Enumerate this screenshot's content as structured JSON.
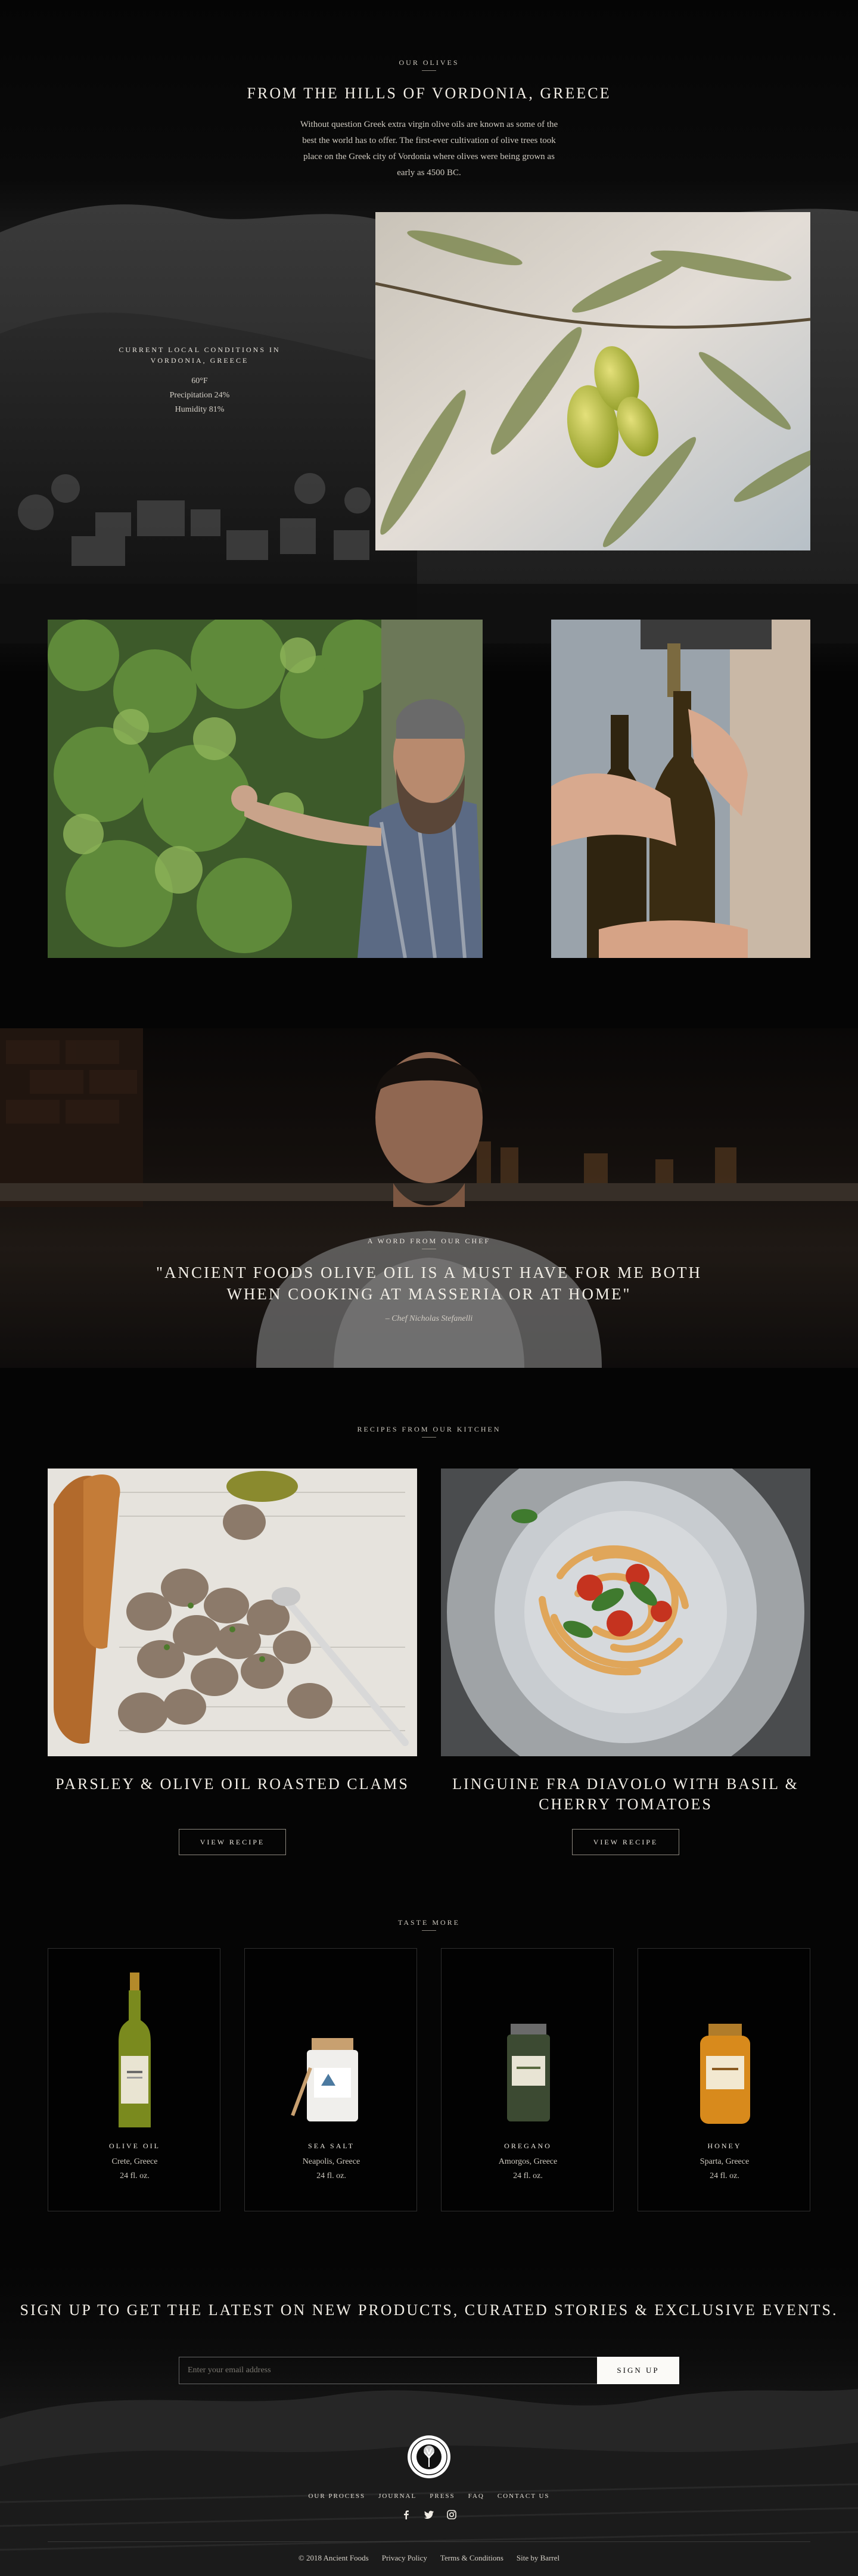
{
  "olives": {
    "eyebrow": "Our Olives",
    "title": "From the Hills of Vordonia, Greece",
    "intro": "Without question Greek extra virgin olive oils are known as some of the best the world has to offer. The first-ever cultivation of olive trees took place on the Greek city of Vordonia where olives were being grown as early as 4500 BC."
  },
  "conditions": {
    "title": "Current Local Conditions in Vordonia, Greece",
    "temperature": "60°F",
    "precipitation": "Precipitation 24%",
    "humidity": "Humidity 81%"
  },
  "chef": {
    "eyebrow": "A Word From Our Chef",
    "quote": "\"Ancient Foods olive oil is a must have for me both when cooking at Masseria or at home\"",
    "cite": "– Chef Nicholas Stefanelli"
  },
  "recipes": {
    "eyebrow": "Recipes From Our Kitchen",
    "items": [
      {
        "title": "Parsley & Olive Oil Roasted Clams",
        "button": "View Recipe"
      },
      {
        "title": "Linguine Fra Diavolo with Basil & Cherry Tomatoes",
        "button": "View Recipe"
      }
    ]
  },
  "taste": {
    "eyebrow": "Taste More",
    "products": [
      {
        "name": "Olive Oil",
        "origin": "Crete, Greece",
        "size": "24 fl. oz."
      },
      {
        "name": "Sea Salt",
        "origin": "Neapolis, Greece",
        "size": "24 fl. oz."
      },
      {
        "name": "Oregano",
        "origin": "Amorgos, Greece",
        "size": "24 fl. oz."
      },
      {
        "name": "Honey",
        "origin": "Sparta, Greece",
        "size": "24 fl. oz."
      }
    ]
  },
  "signup": {
    "title": "Sign Up to Get the Latest on New Products, Curated Stories & Exclusive Events.",
    "placeholder": "Enter your email address",
    "button": "Sign Up"
  },
  "footer": {
    "logo_text": "Ancient Foods",
    "nav": [
      "Our Process",
      "Journal",
      "Press",
      "FAQ",
      "Contact Us"
    ],
    "social": [
      "facebook-icon",
      "twitter-icon",
      "instagram-icon"
    ],
    "copyright": "© 2018 Ancient Foods",
    "privacy": "Privacy Policy",
    "terms": "Terms & Conditions",
    "credit": "Site by Barrel"
  },
  "colors": {
    "background": "#050505",
    "text": "#e8e4dc",
    "button_bg": "#fbfaf7",
    "border": "#8c877e"
  }
}
